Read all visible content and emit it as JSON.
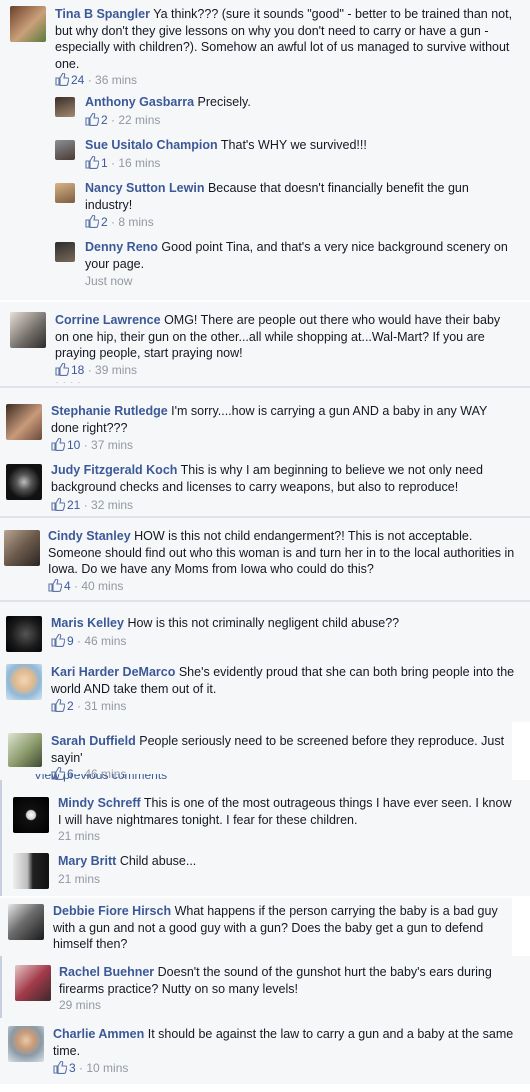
{
  "comments": [
    {
      "name": "Tina B Spangler",
      "text": "Ya think??? (sure it sounds \"good\" - better to be trained than not, but why don't they give lessons on why you don't need to carry or have a gun - especially with children?). Somehow an awful lot of us managed to survive without one.",
      "likes": "24",
      "time": "36 mins"
    },
    {
      "name": "Anthony Gasbarra",
      "text": "Precisely.",
      "likes": "2",
      "time": "22 mins"
    },
    {
      "name": "Sue Usitalo Champion",
      "text": "That's WHY we survived!!!",
      "likes": "1",
      "time": "16 mins"
    },
    {
      "name": "Nancy Sutton Lewin",
      "text": "Because that doesn't financially benefit the gun industry!",
      "likes": "2",
      "time": "8 mins"
    },
    {
      "name": "Denny Reno",
      "text": "Good point Tina, and that's a very nice background scenery on your page.",
      "likes": "",
      "time": "Just now"
    },
    {
      "name": "Corrine Lawrence",
      "text": "OMG! There are people out there who would have their baby on one hip, their gun on the other...all while shopping at...Wal-Mart? If you are praying people, start praying now!",
      "likes": "18",
      "time": "39 mins"
    },
    {
      "name": "Stephanie Rutledge",
      "text": "I'm sorry....how is carrying a gun AND a baby in any WAY done right???",
      "likes": "10",
      "time": "37 mins"
    },
    {
      "name": "Judy Fitzgerald Koch",
      "text": "This is why I am beginning to believe we not only need background checks and licenses to carry weapons, but also to reproduce!",
      "likes": "21",
      "time": "32 mins"
    },
    {
      "name": "Cindy Stanley",
      "text": "HOW is this not child endangerment?! This is not acceptable. Someone should find out who this woman is and turn her in to the local authorities in Iowa. Do we have any Moms from Iowa who could do this?",
      "likes": "4",
      "time": "40 mins"
    },
    {
      "name": "Maris Kelley",
      "text": "How is this not criminally negligent child abuse??",
      "likes": "9",
      "time": "46 mins"
    },
    {
      "name": "Kari Harder DeMarco",
      "text": "She's evidently proud that she can both bring people into the world AND take them out of it.",
      "likes": "2",
      "time": "31 mins"
    },
    {
      "name": "Sarah Duffield",
      "text": "People seriously need to be screened before they reproduce. Just sayin'",
      "likes": "6",
      "time": "46 mins"
    },
    {
      "name": "Mindy Schreff",
      "text": "This is one of the most outrageous things I have ever seen. I know I will have nightmares tonight. I fear for these children.",
      "likes": "",
      "time": "21 mins"
    },
    {
      "name": "Mary Britt",
      "text": "Child abuse...",
      "likes": "",
      "time": "21 mins"
    },
    {
      "name": "Debbie Fiore Hirsch",
      "text": "What happens if the person carrying the baby is a bad guy with a gun and not a good guy with a gun? Does the baby get a gun to defend himself then?",
      "likes": "",
      "time": ""
    },
    {
      "name": "Rachel Buehner",
      "text": "Doesn't the sound of the gunshot hurt the baby's ears during firearms practice? Nutty on so many levels!",
      "likes": "",
      "time": "29 mins"
    },
    {
      "name": "Charlie Ammen",
      "text": "It should be against the law to carry a gun and a baby at the same time.",
      "likes": "3",
      "time": "10 mins"
    }
  ],
  "fragments": {
    "view_previous": "View previous comments"
  },
  "colors": {
    "name": "#3b5998",
    "meta": "#9197a3",
    "text": "#141823",
    "background": "#f6f7f9"
  }
}
